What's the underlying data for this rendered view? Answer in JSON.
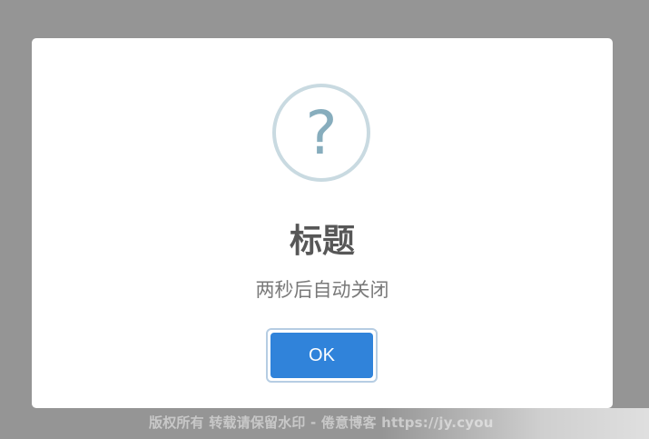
{
  "dialog": {
    "icon": "question-mark-icon",
    "icon_glyph": "?",
    "icon_color": "#87adbd",
    "icon_ring_color": "#c9dae1",
    "title": "标题",
    "message": "两秒后自动关闭",
    "ok_label": "OK",
    "ok_color": "#3083da"
  },
  "overlay": {
    "color": "#959595"
  },
  "watermark": {
    "text": "版权所有 转载请保留水印 - 倦意博客 https://jy.cyou"
  }
}
